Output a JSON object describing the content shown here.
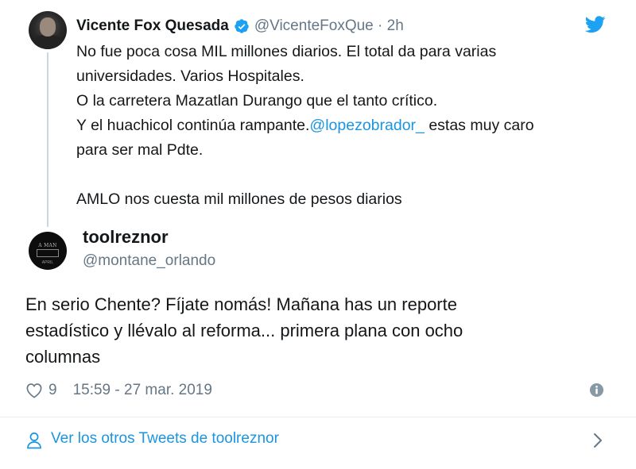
{
  "parent_tweet": {
    "author_name": "Vicente Fox Quesada",
    "author_handle": "@VicenteFoxQue",
    "separator": "·",
    "time_ago": "2h",
    "verified_icon": "verified-badge-icon",
    "text_lines": [
      "No fue poca cosa MIL millones diarios. El total da para varias",
      "universidades. Varios Hospitales.",
      "O la carretera Mazatlan Durango que el tanto crítico.",
      "Y el huachicol continúa rampante."
    ],
    "mention": "@lopezobrador_",
    "mention_after": " estas muy caro",
    "text_line_6": "para ser mal Pdte.",
    "text_line_8": "AMLO nos cuesta mil millones de pesos diarios"
  },
  "reply_tweet": {
    "author_name": "toolreznor",
    "author_handle": "@montane_orlando",
    "avatar_text_top": "A MAN",
    "avatar_text_bottom": "APRIL",
    "text_lines": [
      "En serio Chente? Fíjate nomás! Mañana has un reporte",
      "estadístico y llévalo al reforma... primera plana con ocho",
      "columnas"
    ],
    "like_count": "9",
    "timestamp": "15:59 - 27 mar. 2019"
  },
  "footer": {
    "link_text": "Ver los otros Tweets de toolreznor"
  },
  "colors": {
    "link_blue": "#1b95e0",
    "muted_gray": "#657786",
    "text_dark": "#14171a",
    "divider": "#e6ecf0",
    "twitter_blue": "#1da1f2"
  }
}
